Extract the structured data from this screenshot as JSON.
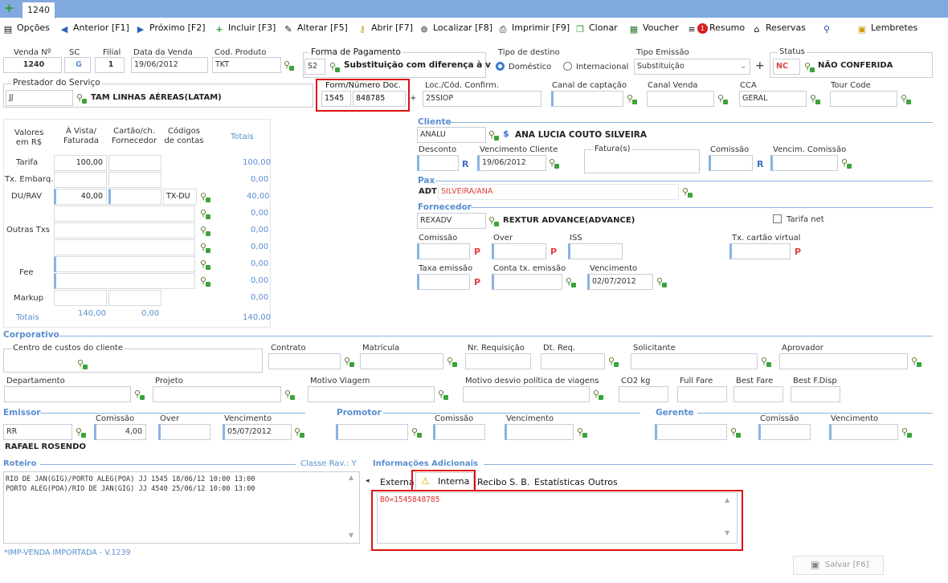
{
  "app": {
    "tab_label": "1240"
  },
  "toolbar": {
    "opcoes": "Opções",
    "anterior": "Anterior [F1]",
    "proximo": "Próximo [F2]",
    "incluir": "Incluir [F3]",
    "alterar": "Alterar [F5]",
    "abrir": "Abrir [F7]",
    "localizar": "Localizar [F8]",
    "imprimir": "Imprimir [F9]",
    "clonar": "Clonar",
    "voucher": "Voucher",
    "resumo": "Resumo",
    "resumo_badge": "1",
    "reservas": "Reservas",
    "lembretes": "Lembretes"
  },
  "header": {
    "venda_label": "Venda Nº",
    "venda": "1240",
    "sc_label": "SC",
    "sc": "G",
    "filial_label": "Filial",
    "filial": "1",
    "data_label": "Data da Venda",
    "data": "19/06/2012",
    "cod_label": "Cod. Produto",
    "cod": "TKT",
    "forma_label": "Forma de Pagamento",
    "forma_code": "S2",
    "forma_desc": "Substituição com diferença à v",
    "destino_label": "Tipo de destino",
    "domestico": "Doméstico",
    "internacional": "Internacional",
    "emissao_label": "Tipo Emissão",
    "emissao": "Substituição",
    "status_label": "Status",
    "status_code": "NC",
    "status_desc": "NÃO CONFERIDA",
    "prestador_label": "Prestador do Serviço",
    "prestador_code": "JJ",
    "prestador_desc": "TAM LINHAS AÉREAS(LATAM)",
    "form_label": "Form/Número Doc.",
    "form_num": "1545",
    "doc_num": "848785",
    "loc_label": "Loc./Cód. Confirm.",
    "loc": "25SIOP",
    "canal_cap_label": "Canal de captação",
    "canal_venda_label": "Canal Venda",
    "cca_label": "CCA",
    "cca": "GERAL",
    "tour_label": "Tour Code"
  },
  "valores": {
    "h_valores": "Valores em R$",
    "h_vista": "À Vista/ Faturada",
    "h_cartao": "Cartão/ch. Fornecedor",
    "h_codigos": "Códigos de contas",
    "h_totais": "Totais",
    "tarifa": "Tarifa",
    "tarifa_v": "100,00",
    "tarifa_t": "100,00",
    "embarq": "Tx. Embarq.",
    "embarq_t": "0,00",
    "du": "DU/RAV",
    "du_v": "40,00",
    "du_cod": "TX-DU",
    "du_t": "40,00",
    "t4": "0,00",
    "outras": "Outras Txs",
    "t5": "0,00",
    "t6": "0,00",
    "fee": "Fee",
    "t7": "0,00",
    "t8": "0,00",
    "markup": "Markup",
    "t9": "0,00",
    "totais": "Totais",
    "tot_vista": "140,00",
    "tot_cartao": "0,00",
    "tot_total": "140,00"
  },
  "cliente": {
    "title": "Cliente",
    "code": "ANALU",
    "name": "ANA LUCIA COUTO SILVEIRA",
    "s": "$",
    "desconto_label": "Desconto",
    "venc_label": "Vencimento Cliente",
    "venc": "19/06/2012",
    "fatura_label": "Fatura(s)",
    "comissao_label": "Comissão",
    "venc_com_label": "Vencim. Comissão",
    "r": "R"
  },
  "pax": {
    "title": "Pax",
    "type": "ADT",
    "name": "SILVEIRA/ANA"
  },
  "fornecedor": {
    "title": "Fornecedor",
    "code": "REXADV",
    "name": "REXTUR ADVANCE(ADVANCE)",
    "tarifa_net": "Tarifa net",
    "comissao_label": "Comissão",
    "over_label": "Over",
    "iss_label": "ISS",
    "tx_cartao_label": "Tx. cartão virtual",
    "taxa_label": "Taxa emissão",
    "conta_label": "Conta tx. emissão",
    "venc_label": "Vencimento",
    "venc": "02/07/2012",
    "p": "P"
  },
  "corporativo": {
    "title": "Corporativo",
    "centro": "Centro de custos do cliente",
    "contrato": "Contrato",
    "matricula": "Matrícula",
    "requisicao": "Nr. Requisição",
    "dtreq": "Dt. Req.",
    "solicitante": "Solicitante",
    "aprovador": "Aprovador",
    "departamento": "Departamento",
    "projeto": "Projeto",
    "motivo": "Motivo Viagem",
    "desvio": "Motivo desvio política de viagens",
    "co2": "CO2 kg",
    "full": "Full Fare",
    "best": "Best Fare",
    "bestf": "Best F.Disp"
  },
  "emissor": {
    "title": "Emissor",
    "comissao": "Comissão",
    "over": "Over",
    "venc": "Vencimento",
    "code": "RR",
    "com_val": "4,00",
    "venc_val": "05/07/2012",
    "name": "RAFAEL ROSENDO"
  },
  "promotor": {
    "title": "Promotor",
    "comissao": "Comissão",
    "venc": "Vencimento"
  },
  "gerente": {
    "title": "Gerente",
    "comissao": "Comissão",
    "venc": "Vencimento"
  },
  "roteiro": {
    "title": "Roteiro",
    "classe": "Classe Rav.: Y",
    "line1": "RIO DE JAN(GIG)/PORTO ALEG(POA) JJ 1545 18/06/12 10:00 13:00",
    "line2": "PORTO ALEG(POA)/RIO DE JAN(GIG) JJ 4540 25/06/12 10:00 13:00",
    "footer": "*IMP-VENDA IMPORTADA - V.1239"
  },
  "info": {
    "title": "Informações Adicionais",
    "tabs": [
      "Externa",
      "Interna",
      "Recibo S. B.",
      "Estatísticas",
      "Outros"
    ],
    "text": "BO=1545848785"
  },
  "save": "Salvar [F6]",
  "colors": {
    "accent": "#5a8ed0",
    "highlight": "#e01010",
    "topbar": "#7fa9df"
  }
}
